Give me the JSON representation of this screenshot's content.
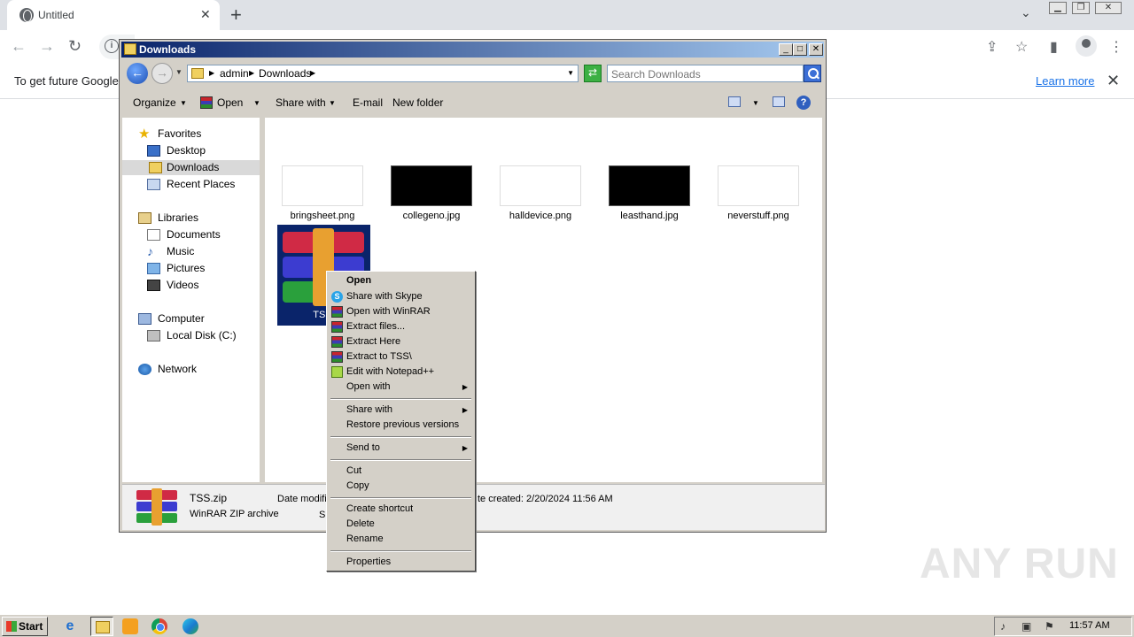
{
  "browser": {
    "tab_title": "Untitled",
    "tab_close": "✕",
    "new_tab": "+",
    "chevron": "⌄",
    "infobar_message": "To get future Google",
    "infobar_link": "Learn more",
    "infobar_close": "✕",
    "icons": [
      "globe-icon",
      "back-arrow-icon",
      "forward-arrow-icon",
      "reload-icon",
      "info-icon",
      "share-icon",
      "star-icon",
      "side-panel-icon",
      "profile-icon",
      "kebab-menu-icon"
    ]
  },
  "explorer": {
    "title": "Downloads",
    "breadcrumbs": [
      "admin",
      "Downloads"
    ],
    "search_placeholder": "Search Downloads",
    "toolbar": {
      "organize": "Organize",
      "open": "Open",
      "share_with": "Share with",
      "email": "E-mail",
      "new_folder": "New folder"
    },
    "nav": {
      "favorites": "Favorites",
      "desktop": "Desktop",
      "downloads": "Downloads",
      "recent_places": "Recent Places",
      "libraries": "Libraries",
      "documents": "Documents",
      "music": "Music",
      "pictures": "Pictures",
      "videos": "Videos",
      "computer": "Computer",
      "local_disk": "Local Disk (C:)",
      "network": "Network"
    },
    "files": [
      {
        "name": "bringsheet.png",
        "thumb": "white"
      },
      {
        "name": "collegeno.jpg",
        "thumb": "black"
      },
      {
        "name": "halldevice.png",
        "thumb": "white"
      },
      {
        "name": "leasthand.jpg",
        "thumb": "black"
      },
      {
        "name": "neverstuff.png",
        "thumb": "white"
      }
    ],
    "selected_file_label": "TSS.",
    "details": {
      "name": "TSS.zip",
      "type": "WinRAR ZIP archive",
      "date_modified_label": "Date modifi",
      "size_label": "Si",
      "date_created": "te created:  2/20/2024 11:56 AM"
    }
  },
  "context_menu": {
    "open": "Open",
    "share_with_skype": "Share with Skype",
    "open_with_winrar": "Open with WinRAR",
    "extract_files": "Extract files...",
    "extract_here": "Extract Here",
    "extract_to": "Extract to TSS\\",
    "edit_with_notepadpp": "Edit with Notepad++",
    "open_with": "Open with",
    "share_with": "Share with",
    "restore_previous_versions": "Restore previous versions",
    "send_to": "Send to",
    "cut": "Cut",
    "copy": "Copy",
    "create_shortcut": "Create shortcut",
    "delete": "Delete",
    "rename": "Rename",
    "properties": "Properties"
  },
  "watermark": "ANY RUN",
  "taskbar": {
    "start": "Start",
    "clock": "11:57 AM"
  },
  "colors": {
    "titlebar_start": "#0a246a",
    "titlebar_end": "#a6caf0",
    "selection": "#0a246a",
    "classic_gray": "#d4d0c8",
    "link_blue": "#1a73e8"
  }
}
